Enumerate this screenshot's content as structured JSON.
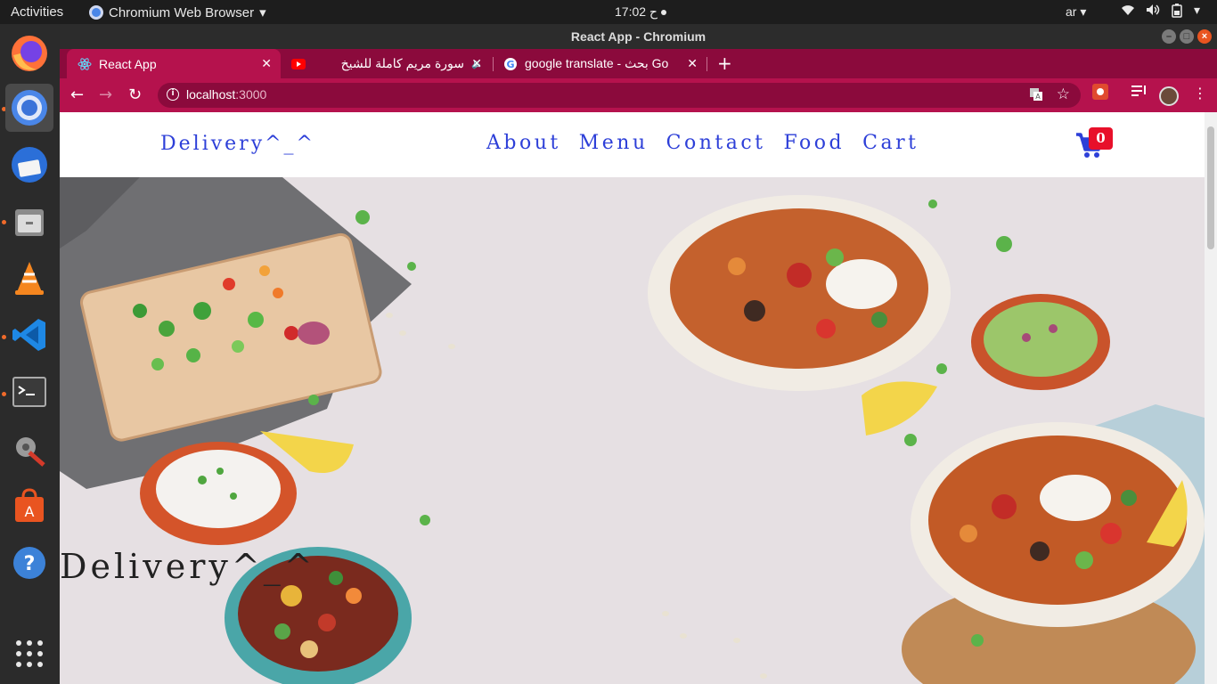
{
  "desktop": {
    "activities_label": "Activities",
    "app_menu_label": "Chromium Web Browser",
    "clock": "ح 17:02",
    "keyboard_layout": "ar"
  },
  "dock": {
    "apps": [
      "firefox-icon",
      "chromium-icon",
      "thunderbird-icon",
      "files-icon",
      "vlc-icon",
      "vscode-icon",
      "terminal-icon",
      "settings-icon",
      "software-center-icon",
      "help-icon",
      "app-grid-icon"
    ]
  },
  "browser": {
    "window_title": "React App - Chromium",
    "tabs": [
      {
        "title": "React App",
        "icon": "react-icon"
      },
      {
        "title": "سورة مريم كاملة للشيخ",
        "icon": "youtube-icon"
      },
      {
        "title": "google translate - بحث Go",
        "icon": "google-icon"
      }
    ],
    "url_host": "localhost",
    "url_port": ":3000"
  },
  "site": {
    "brand": "Delivery^_^",
    "nav_links": [
      "About",
      "Menu",
      "Contact",
      "Food",
      "Cart"
    ],
    "cart_count": "0",
    "hero_title": "Delivery^_^",
    "colors": {
      "link": "#2d3fd8",
      "badge": "#e8102a",
      "browser_theme": "#b5124d"
    }
  }
}
